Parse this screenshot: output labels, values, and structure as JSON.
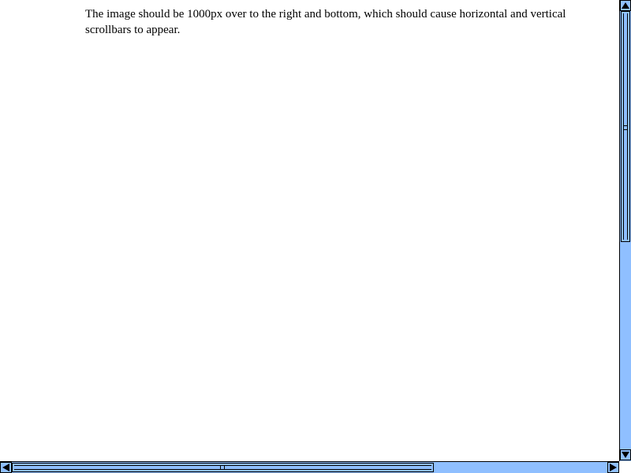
{
  "page": {
    "text": "The image should be 1000px over to the right and bottom, which should cause horizontal and vertical scrollbars to appear."
  },
  "scrollbars": {
    "color": "#8fbfff",
    "vertical": {
      "up_icon": "triangle-up-icon",
      "down_icon": "triangle-down-icon"
    },
    "horizontal": {
      "left_icon": "triangle-left-icon",
      "right_icon": "triangle-right-icon"
    }
  }
}
